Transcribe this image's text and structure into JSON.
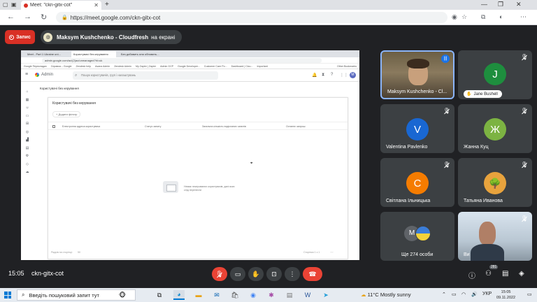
{
  "browser": {
    "tab_title": "Meet: \"ckn-gitx-cot\"",
    "url": "https://meet.google.com/ckn-gitx-cot"
  },
  "meet": {
    "record_label": "Запис",
    "presenter_name": "Maksym Kushchenko - Cloudfresh",
    "presenter_suffix": "на екрані",
    "time": "15:05",
    "meeting_code": "ckn-gitx-cot",
    "participant_count_badge": "281"
  },
  "participants": [
    {
      "name": "Maksym Kushchenko - Cl...",
      "type": "video"
    },
    {
      "name": "Jane Bushell",
      "initial": "J",
      "color": "#1e8e3e",
      "type": "avatar"
    },
    {
      "name": "Valentina Pavlenko",
      "initial": "V",
      "color": "#1967d2",
      "type": "avatar"
    },
    {
      "name": "Жанна Куц",
      "initial": "Ж",
      "color": "#7cb342",
      "type": "avatar"
    },
    {
      "name": "Світлана Ільницька",
      "initial": "С",
      "color": "#f57c00",
      "type": "avatar"
    },
    {
      "name": "Татьяна Иванова",
      "initial": "",
      "color": "#e8a33d",
      "type": "avatar"
    },
    {
      "name": "Ще 274 особи",
      "initial": "M",
      "type": "more"
    },
    {
      "name": "Ви",
      "type": "video"
    }
  ],
  "shared_screen": {
    "tabs": [
      "Meet - Part 1 Ukraine uni...",
      "Користувачі без керування",
      "Без добавить или обновить..."
    ],
    "url": "admin.google.com/ac/(2)ac/unmanaged?hl=uk",
    "bookmarks": [
      "Google Перекладач",
      "Справка – Google",
      "Zendesk help",
      "Asana Admin",
      "Zendesk Admin",
      "My Zapier | Zapier",
      "Admin GCP",
      "Google Developer...",
      "Customer Care Po...",
      "Dashboard | Clou...",
      "Important",
      "Other Bookmarks"
    ],
    "app_name": "Admin",
    "search_placeholder": "Пошук користувачів, груп і налаштувань",
    "avatar_initial": "M",
    "breadcrumb": "Користувачі без керування",
    "card_title": "Користувачі без керування",
    "add_filter": "+ Додати фільтр",
    "columns": [
      "Електронна адреса користувача",
      "Статус запиту",
      "Загальна кількість надісланих запитів",
      "Останнє запрош"
    ],
    "empty_message": "Немає некерованих користувачів, дані яких слід перенести",
    "rows_per_page_label": "Рядків на сторінці:",
    "rows_per_page_value": "50",
    "pagination": "Сторінка 1 з 1"
  },
  "taskbar": {
    "search_placeholder": "Введіть пошуковий запит тут",
    "weather": "11°C  Mostly sunny",
    "language": "УКР",
    "time": "15:05",
    "date": "09.11.2022"
  }
}
